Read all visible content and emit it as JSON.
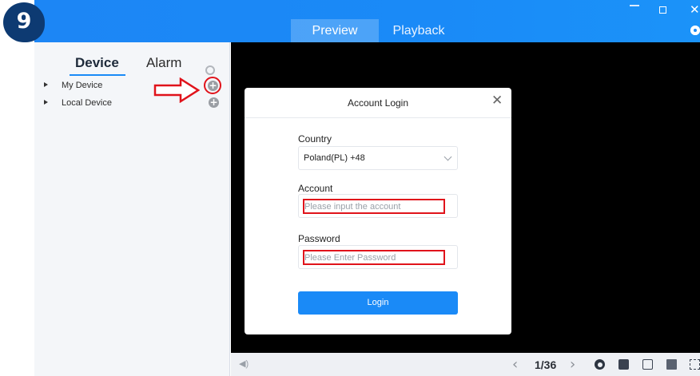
{
  "step_badge": "9",
  "titlebar": {
    "tabs": [
      {
        "label": "Preview",
        "active": true
      },
      {
        "label": "Playback",
        "active": false
      }
    ],
    "accent_color": "#1a8af7"
  },
  "sidebar": {
    "tabs": [
      {
        "label": "Device",
        "active": true
      },
      {
        "label": "Alarm",
        "active": false
      }
    ],
    "items": [
      {
        "label": "My Device",
        "icon": "plus-circle-icon",
        "highlighted": true
      },
      {
        "label": "Local Device",
        "icon": "plus-circle-icon",
        "highlighted": false
      }
    ],
    "annotation": {
      "icon": "red-arrow-icon",
      "color": "#e0131b"
    }
  },
  "dialog": {
    "title": "Account Login",
    "country": {
      "label": "Country",
      "value": "Poland(PL) +48"
    },
    "account": {
      "label": "Account",
      "placeholder": "Please input the account"
    },
    "password": {
      "label": "Password",
      "placeholder": "Please Enter Password"
    },
    "login_label": "Login"
  },
  "bottom_bar": {
    "page_indicator": "1/36",
    "tool_icons": [
      "refresh-icon",
      "layout-icon",
      "close-all-icon",
      "grid-icon",
      "fullscreen-icon"
    ]
  }
}
